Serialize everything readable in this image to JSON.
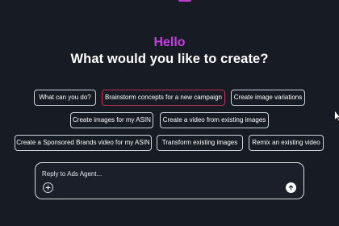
{
  "greeting": "Hello",
  "headline": "What would you like to create?",
  "suggestions": [
    {
      "label": "What can you do?"
    },
    {
      "label": "Brainstorm concepts for a new campaign"
    },
    {
      "label": "Create image variations"
    },
    {
      "label": "Create images for my ASIN"
    },
    {
      "label": "Create a video from existing images"
    },
    {
      "label": "Create a Sponsored Brands video for my ASIN"
    },
    {
      "label": "Transform existing images"
    },
    {
      "label": "Remix an existing video"
    }
  ],
  "composer": {
    "placeholder": "Reply to Ads Agent...",
    "value": ""
  },
  "icons": {
    "attach": "plus-icon",
    "send": "arrow-up-icon",
    "pointer": "mouse-cursor-icon"
  },
  "colors": {
    "background": "#161b24",
    "greeting_accent": "#c53fe0",
    "selected_chip_border": "#c0325a"
  }
}
